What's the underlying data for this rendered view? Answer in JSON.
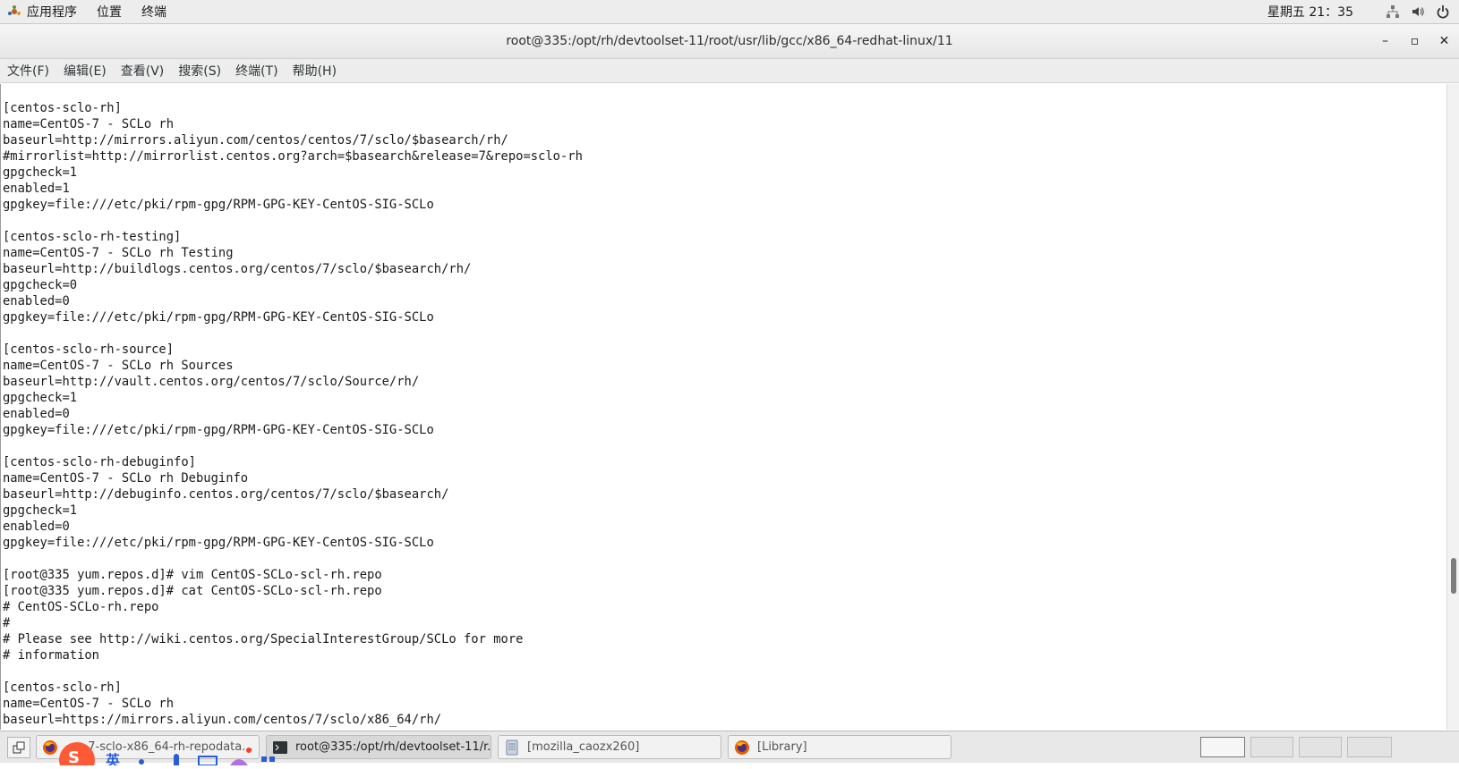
{
  "topbar": {
    "apps_label": "应用程序",
    "places_label": "位置",
    "terminal_label": "终端",
    "clock": "星期五 21：35"
  },
  "window": {
    "title": "root@335:/opt/rh/devtoolset-11/root/usr/lib/gcc/x86_64-redhat-linux/11",
    "minimize": "–",
    "maximize": "▫",
    "close": "✕"
  },
  "menubar": {
    "items": [
      "文件(F)",
      "编辑(E)",
      "查看(V)",
      "搜索(S)",
      "终端(T)",
      "帮助(H)"
    ]
  },
  "terminal": {
    "lines": [
      "[centos-sclo-rh]",
      "name=CentOS-7 - SCLo rh",
      "baseurl=http://mirrors.aliyun.com/centos/centos/7/sclo/$basearch/rh/",
      "#mirrorlist=http://mirrorlist.centos.org?arch=$basearch&release=7&repo=sclo-rh",
      "gpgcheck=1",
      "enabled=1",
      "gpgkey=file:///etc/pki/rpm-gpg/RPM-GPG-KEY-CentOS-SIG-SCLo",
      "",
      "[centos-sclo-rh-testing]",
      "name=CentOS-7 - SCLo rh Testing",
      "baseurl=http://buildlogs.centos.org/centos/7/sclo/$basearch/rh/",
      "gpgcheck=0",
      "enabled=0",
      "gpgkey=file:///etc/pki/rpm-gpg/RPM-GPG-KEY-CentOS-SIG-SCLo",
      "",
      "[centos-sclo-rh-source]",
      "name=CentOS-7 - SCLo rh Sources",
      "baseurl=http://vault.centos.org/centos/7/sclo/Source/rh/",
      "gpgcheck=1",
      "enabled=0",
      "gpgkey=file:///etc/pki/rpm-gpg/RPM-GPG-KEY-CentOS-SIG-SCLo",
      "",
      "[centos-sclo-rh-debuginfo]",
      "name=CentOS-7 - SCLo rh Debuginfo",
      "baseurl=http://debuginfo.centos.org/centos/7/sclo/$basearch/",
      "gpgcheck=1",
      "enabled=0",
      "gpgkey=file:///etc/pki/rpm-gpg/RPM-GPG-KEY-CentOS-SIG-SCLo",
      "",
      "[root@335 yum.repos.d]# vim CentOS-SCLo-scl-rh.repo",
      "[root@335 yum.repos.d]# cat CentOS-SCLo-scl-rh.repo",
      "# CentOS-SCLo-rh.repo",
      "#",
      "# Please see http://wiki.centos.org/SpecialInterestGroup/SCLo for more",
      "# information",
      "",
      "[centos-sclo-rh]",
      "name=CentOS-7 - SCLo rh",
      "baseurl=https://mirrors.aliyun.com/centos/7/sclo/x86_64/rh/"
    ]
  },
  "taskbar": {
    "tasks": [
      {
        "label": "...o-7-sclo-x86_64-rh-repodata..."
      },
      {
        "label": "root@335:/opt/rh/devtoolset-11/r..."
      },
      {
        "label": "[mozilla_caozx260]"
      },
      {
        "label": "[Library]"
      }
    ]
  },
  "colors": {
    "terminal_bg": "#ffffff",
    "terminal_fg": "#1a1a1a",
    "topbar_bg": "#ededed",
    "firefox_orange": "#e66000",
    "sogou_red": "#ff5a36"
  }
}
